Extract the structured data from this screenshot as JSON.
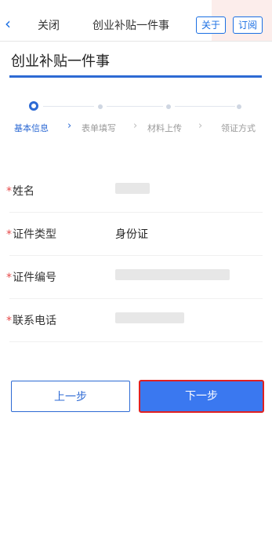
{
  "header": {
    "close_label": "关闭",
    "nav_title": "创业补贴一件事",
    "about_label": "关于",
    "subscribe_label": "订阅"
  },
  "page_title": "创业补贴一件事",
  "steps": [
    {
      "label": "基本信息",
      "active": true
    },
    {
      "label": "表单填写",
      "active": false
    },
    {
      "label": "材料上传",
      "active": false
    },
    {
      "label": "领证方式",
      "active": false
    }
  ],
  "form": {
    "fields": [
      {
        "label": "姓名",
        "required": true,
        "value": ""
      },
      {
        "label": "证件类型",
        "required": true,
        "value": "身份证"
      },
      {
        "label": "证件编号",
        "required": true,
        "value": ""
      },
      {
        "label": "联系电话",
        "required": true,
        "value": ""
      }
    ]
  },
  "buttons": {
    "prev": "上一步",
    "next": "下一步"
  },
  "colors": {
    "accent": "#2d6ad4",
    "button": "#3a78f0",
    "required": "#e64a4a",
    "highlight": "#e02020"
  }
}
